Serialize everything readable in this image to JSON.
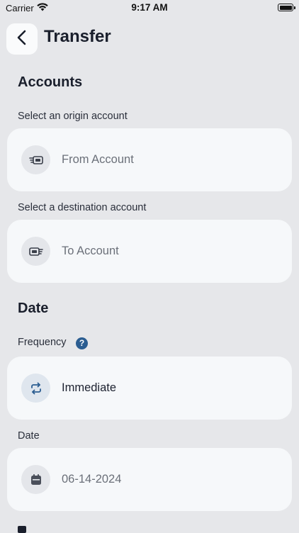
{
  "status_bar": {
    "carrier": "Carrier",
    "time": "9:17 AM"
  },
  "header": {
    "title": "Transfer"
  },
  "accounts": {
    "heading": "Accounts",
    "origin_label": "Select an origin account",
    "origin_placeholder": "From Account",
    "origin_icon": "card-outgoing-icon",
    "destination_label": "Select a destination account",
    "destination_placeholder": "To Account",
    "destination_icon": "card-incoming-icon"
  },
  "date_section": {
    "heading": "Date",
    "frequency_label": "Frequency",
    "frequency_value": "Immediate",
    "frequency_icon": "repeat-icon",
    "date_label": "Date",
    "date_value": "06-14-2024",
    "date_icon": "calendar-icon"
  },
  "colors": {
    "accent": "#2b5d91",
    "background": "#e6e7ea",
    "card": "#f6f8fa"
  }
}
